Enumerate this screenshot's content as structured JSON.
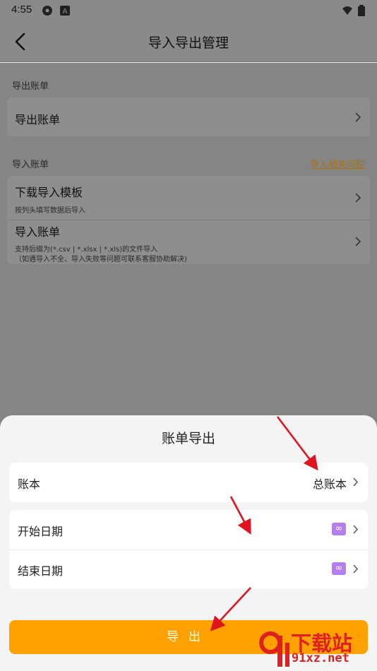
{
  "status_bar": {
    "time": "4:55"
  },
  "header": {
    "title": "导入导出管理"
  },
  "export_section": {
    "label": "导出账单",
    "row_title": "导出账单"
  },
  "import_section": {
    "label": "导入账单",
    "help_link": "导入相关问题",
    "rows": [
      {
        "title": "下载导入模板",
        "subtitle": "按列头填写数据后导入"
      },
      {
        "title": "导入账单",
        "subtitle": "支持后缀为(*.csv | *.xlsx | *.xls)的文件导入",
        "subtitle2": "（如遇导入不全、导入失败等问题可联系客服协助解决)"
      }
    ]
  },
  "sheet": {
    "title": "账单导出",
    "ledger": {
      "label": "账本",
      "value": "总账本"
    },
    "start_date": {
      "label": "开始日期",
      "value": "∞"
    },
    "end_date": {
      "label": "结束日期",
      "value": "∞"
    },
    "export_button": "导出"
  },
  "watermark": {
    "name": "下载站",
    "url": "91xz.net"
  },
  "colors": {
    "accent": "#ffa200",
    "link": "#a77310",
    "badge": "#b37feb",
    "arrow": "#e0141e"
  },
  "icons": [
    "back-arrow-icon",
    "chevron-right-icon",
    "wifi-icon",
    "battery-icon",
    "infinity-icon"
  ]
}
